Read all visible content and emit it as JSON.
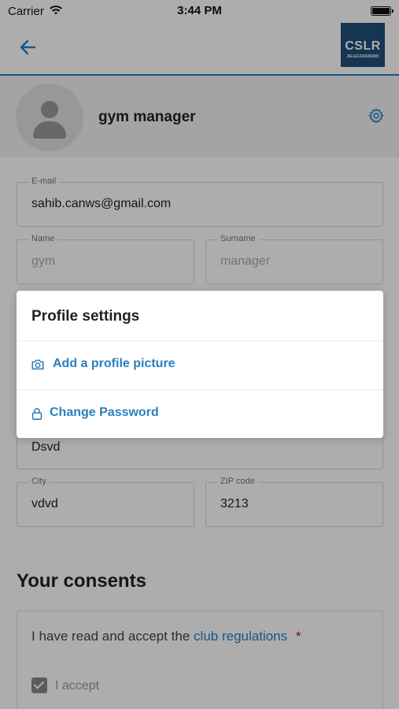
{
  "status_bar": {
    "carrier": "Carrier",
    "time": "3:44 PM"
  },
  "nav": {
    "back_icon": "arrow-left-icon",
    "logo_text": "CSLR",
    "logo_subtext": "JELECZARZEWO"
  },
  "profile": {
    "name": "gym manager",
    "settings_icon": "gear-icon"
  },
  "form": {
    "email": {
      "label": "E-mail",
      "value": "sahib.canws@gmail.com"
    },
    "name": {
      "label": "Name",
      "value": "gym"
    },
    "surname": {
      "label": "Surname",
      "value": "manager"
    },
    "street": {
      "value": "Dsvd"
    },
    "city": {
      "label": "City",
      "value": "vdvd"
    },
    "zip": {
      "label": "ZIP code",
      "value": "3213"
    }
  },
  "consents": {
    "title": "Your consents",
    "text": "I have read and accept the",
    "link": "club regulations",
    "required_mark": "*",
    "checkbox_label": "I accept",
    "checked": true
  },
  "modal": {
    "title": "Profile settings",
    "items": [
      {
        "label": "Add a profile picture",
        "icon": "camera-icon"
      },
      {
        "label": "Change Password",
        "icon": "lock-icon"
      }
    ]
  },
  "colors": {
    "accent": "#2b7fbf",
    "required": "#d0021b",
    "logo_bg": "#1f4e7a"
  }
}
